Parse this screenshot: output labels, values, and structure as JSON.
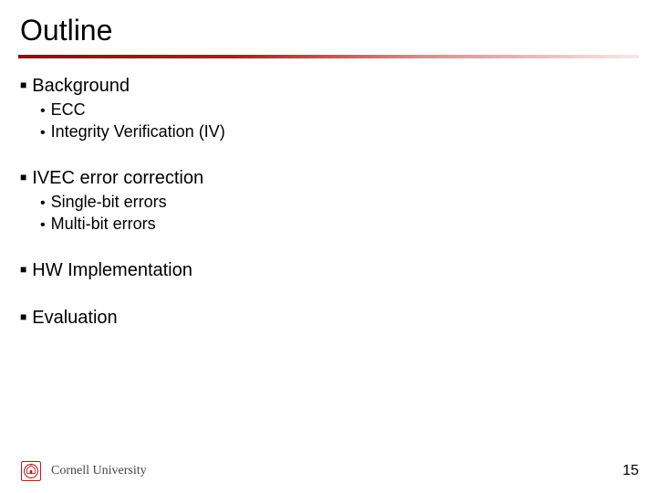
{
  "title": "Outline",
  "sections": [
    {
      "heading": "Background",
      "items": [
        "ECC",
        "Integrity Verification (IV)"
      ]
    },
    {
      "heading": "IVEC error correction",
      "items": [
        "Single-bit errors",
        "Multi-bit errors"
      ]
    },
    {
      "heading": "HW Implementation",
      "items": []
    },
    {
      "heading": "Evaluation",
      "items": []
    }
  ],
  "footer": {
    "university": "Cornell University",
    "page_number": "15"
  }
}
